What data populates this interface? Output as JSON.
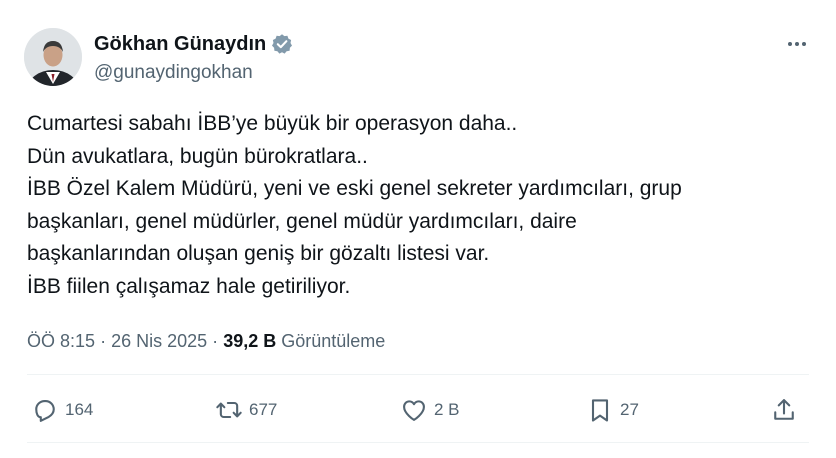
{
  "author": {
    "display_name": "Gökhan Günaydın",
    "handle": "@gunaydingokhan",
    "verified": true,
    "avatar_icon": "profile-photo"
  },
  "tweet": {
    "lines": [
      "Cumartesi sabahı İBB’ye büyük bir operasyon daha..",
      "Dün avukatlara, bugün bürokratlara..",
      "İBB Özel Kalem Müdürü, yeni ve eski genel sekreter yardımcıları, grup",
      "başkanları, genel müdürler, genel müdür yardımcıları, daire",
      "başkanlarından oluşan geniş bir gözaltı listesi var.",
      "İBB fiilen çalışamaz hale getiriliyor."
    ]
  },
  "meta": {
    "time": "ÖÖ 8:15",
    "separator": "·",
    "date": "26 Nis 2025",
    "views_count": "39,2 B",
    "views_label": "Görüntüleme"
  },
  "actions": {
    "replies": "164",
    "retweets": "677",
    "likes": "2 B",
    "bookmarks": "27"
  },
  "colors": {
    "text_primary": "#0f1419",
    "text_secondary": "#536471",
    "verified_badge": "#829aab",
    "divider": "#eff3f4"
  }
}
